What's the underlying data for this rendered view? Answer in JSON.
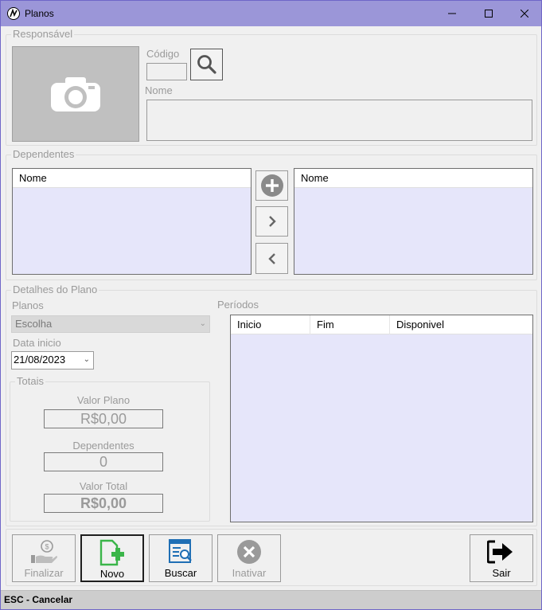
{
  "window": {
    "title": "Planos",
    "minimize_icon": "minimize-icon",
    "maximize_icon": "maximize-icon",
    "close_icon": "close-icon"
  },
  "responsavel": {
    "legend": "Responsável",
    "codigo_label": "Código",
    "codigo_value": "",
    "nome_label": "Nome",
    "nome_value": "",
    "photo_icon": "camera-icon",
    "search_icon": "search-icon"
  },
  "dependentes": {
    "legend": "Dependentes",
    "left_list": {
      "columns": [
        "Nome"
      ],
      "rows": []
    },
    "right_list": {
      "columns": [
        "Nome"
      ],
      "rows": []
    },
    "add_icon": "plus-circle-icon",
    "move_right_icon": "chevron-right-icon",
    "move_left_icon": "chevron-left-icon"
  },
  "detalhes": {
    "legend": "Detalhes do Plano",
    "planos_label": "Planos",
    "planos_selected": "Escolha",
    "data_inicio_label": "Data inicio",
    "data_inicio_value": "21/08/2023",
    "periodos_label": "Períodos",
    "periodos_columns": [
      "Inicio",
      "Fim",
      "Disponivel"
    ],
    "periodos_rows": []
  },
  "totais": {
    "legend": "Totais",
    "valor_plano_label": "Valor Plano",
    "valor_plano_value": "R$0,00",
    "dependentes_label": "Dependentes",
    "dependentes_value": "0",
    "valor_total_label": "Valor Total",
    "valor_total_value": "R$0,00"
  },
  "actions": {
    "finalizar": {
      "label": "Finalizar",
      "icon": "money-hand-icon",
      "enabled": false
    },
    "novo": {
      "label": "Novo",
      "icon": "new-document-icon",
      "enabled": true
    },
    "buscar": {
      "label": "Buscar",
      "icon": "search-document-icon",
      "enabled": true
    },
    "inativar": {
      "label": "Inativar",
      "icon": "cancel-circle-icon",
      "enabled": false
    },
    "sair": {
      "label": "Sair",
      "icon": "exit-icon",
      "enabled": true
    }
  },
  "statusbar": {
    "text": "ESC - Cancelar"
  },
  "colors": {
    "titlebar": "#9b96d8",
    "list_background": "#e6e6fa",
    "accent_green": "#3bb54a",
    "accent_blue": "#1f6fb5"
  }
}
